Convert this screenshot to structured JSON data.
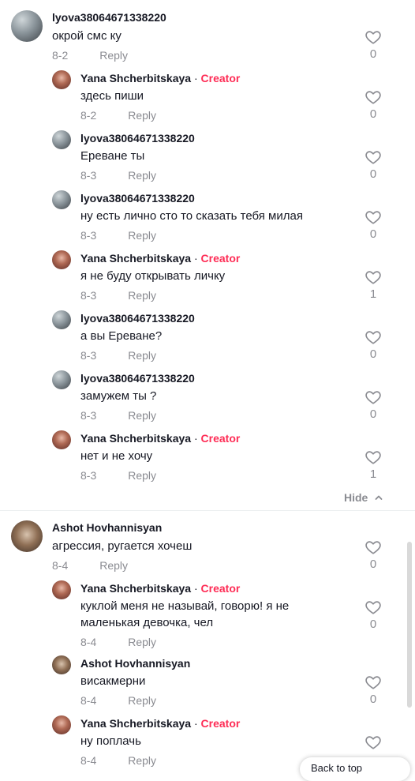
{
  "creator_label": "Creator",
  "separator": "·",
  "reply_label": "Reply",
  "hide_label": "Hide",
  "sort_label": "Back to top",
  "colors": {
    "creator": "#fe2c55",
    "muted": "#8a8b91",
    "text": "#161823"
  },
  "comments": [
    {
      "user": "lyova38064671338220",
      "text": "окрой смс ку",
      "date": "8-2",
      "likes": "0"
    },
    {
      "user": "Yana Shcherbitskaya",
      "text": "здесь пиши",
      "date": "8-2",
      "likes": "0"
    },
    {
      "user": "lyova38064671338220",
      "text": "Ереване ты",
      "date": "8-3",
      "likes": "0"
    },
    {
      "user": "lyova38064671338220",
      "text": "ну есть лично сто то сказать тебя милая",
      "date": "8-3",
      "likes": "0"
    },
    {
      "user": "Yana Shcherbitskaya",
      "text": "я не буду открывать личку",
      "date": "8-3",
      "likes": "1"
    },
    {
      "user": "lyova38064671338220",
      "text": "а вы Ереване?",
      "date": "8-3",
      "likes": "0"
    },
    {
      "user": "lyova38064671338220",
      "text": "замужем ты ?",
      "date": "8-3",
      "likes": "0"
    },
    {
      "user": "Yana Shcherbitskaya",
      "text": "нет и не хочу",
      "date": "8-3",
      "likes": "1"
    },
    {
      "user": "Ashot Hovhannisyan",
      "text": "агрессия, ругается хочеш",
      "date": "8-4",
      "likes": "0"
    },
    {
      "user": "Yana Shcherbitskaya",
      "text": "куклой меня не называй, говорю! я не маленькая девочка, чел",
      "date": "8-4",
      "likes": "0"
    },
    {
      "user": "Ashot Hovhannisyan",
      "text": "висакмерни",
      "date": "8-4",
      "likes": "0"
    },
    {
      "user": "Yana Shcherbitskaya",
      "text": "ну поплачь",
      "date": "8-4",
      "likes": ""
    }
  ]
}
